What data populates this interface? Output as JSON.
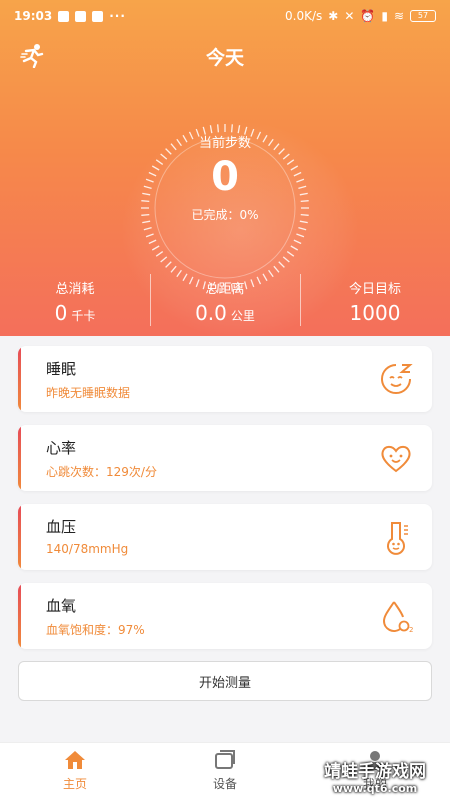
{
  "status_bar": {
    "time": "19:03",
    "network_speed": "0.0K/s",
    "battery": "57"
  },
  "header": {
    "title": "今天"
  },
  "steps": {
    "label": "当前步数",
    "value": "0",
    "completion": "已完成：0%"
  },
  "stats": [
    {
      "label": "总消耗",
      "value": "0",
      "unit": "千卡"
    },
    {
      "label": "总距离",
      "value": "0.0",
      "unit": "公里"
    },
    {
      "label": "今日目标",
      "value": "1000",
      "unit": ""
    }
  ],
  "cards": [
    {
      "title": "睡眠",
      "subtitle": "昨晚无睡眠数据",
      "icon": "sleep-icon"
    },
    {
      "title": "心率",
      "subtitle": "心跳次数：129次/分",
      "icon": "heart-icon"
    },
    {
      "title": "血压",
      "subtitle": "140/78mmHg",
      "icon": "thermometer-icon"
    },
    {
      "title": "血氧",
      "subtitle": "血氧饱和度：97%",
      "icon": "oxygen-drop-icon"
    }
  ],
  "measure_button": "开始测量",
  "tabs": [
    {
      "label": "主页",
      "icon": "home-icon",
      "active": true
    },
    {
      "label": "设备",
      "icon": "device-icon",
      "active": false
    },
    {
      "label": "我的",
      "icon": "profile-icon",
      "active": false
    }
  ],
  "watermark": {
    "name": "靖蛙手游戏网",
    "url": "www.qt6.com"
  },
  "colors": {
    "accent": "#f08b3a",
    "hero_top": "#f7a44a",
    "hero_bottom": "#f46f5b",
    "card_bar": "#e64b58"
  }
}
